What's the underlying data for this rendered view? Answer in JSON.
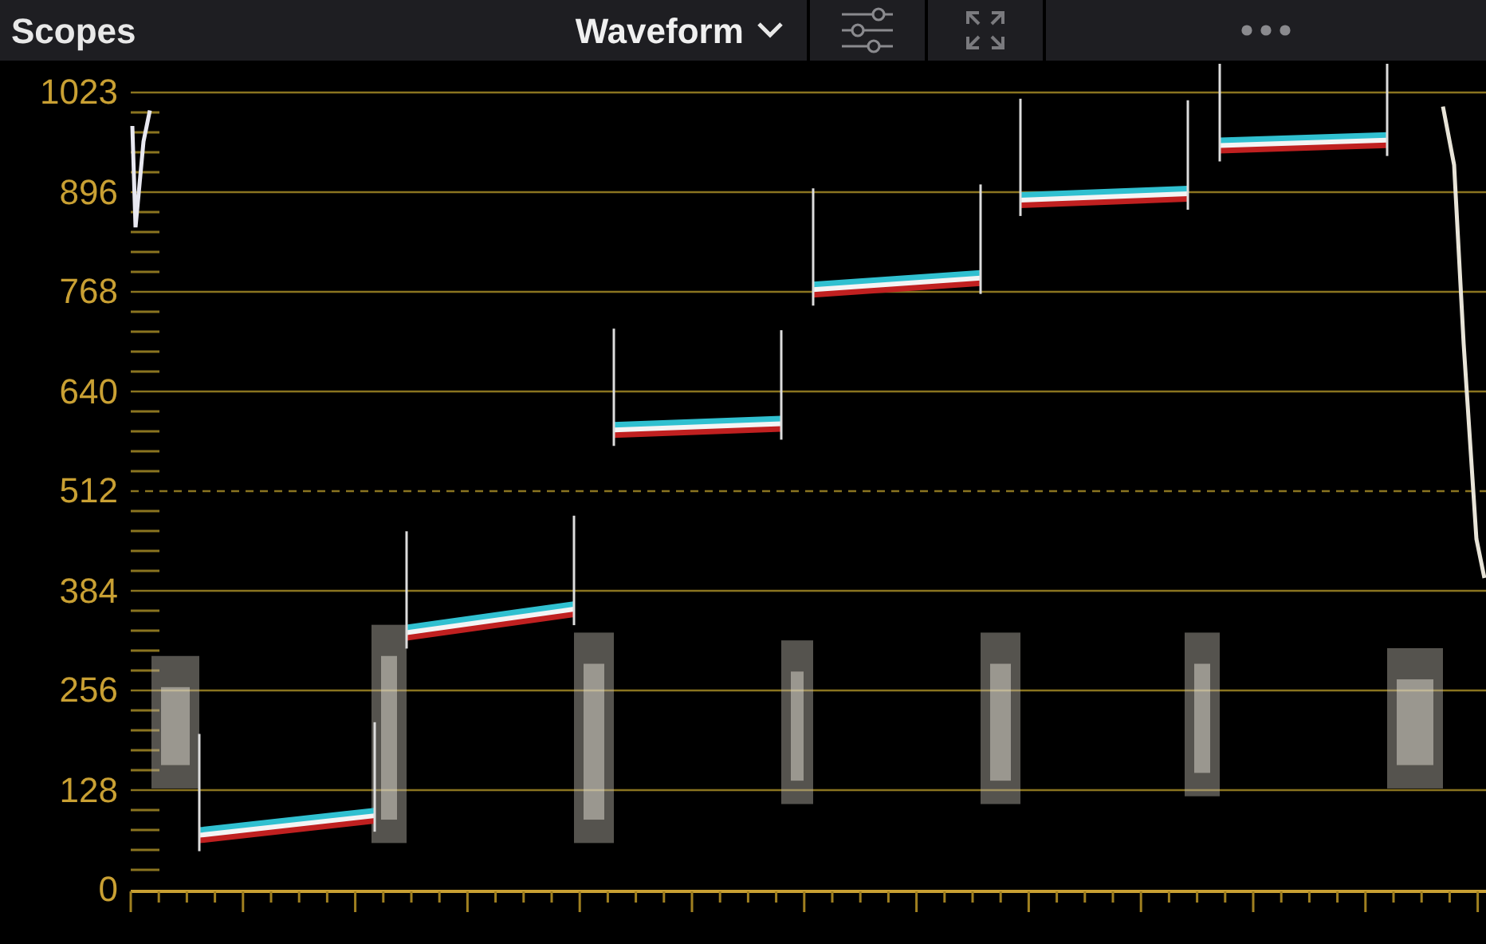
{
  "panel": {
    "title": "Scopes"
  },
  "scope_selector": {
    "value": "Waveform"
  },
  "y_axis_labels": [
    "1023",
    "896",
    "768",
    "640",
    "512",
    "384",
    "256",
    "128",
    "0"
  ]
}
